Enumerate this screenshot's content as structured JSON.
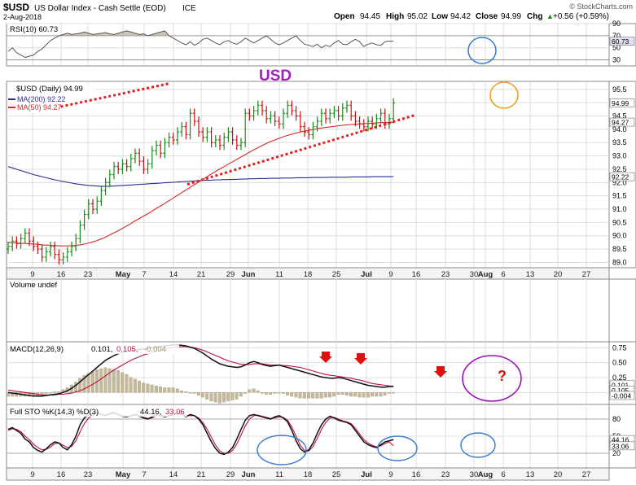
{
  "header": {
    "symbol": "$USD",
    "name": "US Dollar Index - Cash Settle (EOD)",
    "exchange": "ICE",
    "date": "2-Aug-2018",
    "source": "© StockCharts.com",
    "ohlc": [
      {
        "label": "Open",
        "value": "94.45"
      },
      {
        "label": "High",
        "value": "95.02"
      },
      {
        "label": "Low",
        "value": "94.42"
      },
      {
        "label": "Close",
        "value": "94.99"
      },
      {
        "label": "Chg",
        "value": "+0.56 (+0.59%)"
      }
    ],
    "chg_marker": "▲"
  },
  "annotations": {
    "usd_label": "USD",
    "question_mark": "?"
  },
  "colors": {
    "bullish": "#1a8a1a",
    "bearish": "#cc1111",
    "ma200": "#2c2c9a",
    "ma50": "#d42a2a",
    "trendline": "#e02020",
    "rsi": "#555555",
    "volume_hist": "#c4b99a",
    "macd": "#111111",
    "signal": "#c01040",
    "sto_k": "#111111",
    "sto_d": "#c01040",
    "circle_blue": "#3f7fd0",
    "circle_orange": "#f0a020",
    "circle_purple": "#9a10c0",
    "arrow": "#e01010",
    "usd_text": "#a020c0"
  },
  "chart_data": [
    {
      "type": "line",
      "panel": "RSI",
      "legend": "RSI(10) 60.73",
      "ylim": [
        20,
        90
      ],
      "yticks": [
        "90",
        "70",
        "50",
        "30"
      ],
      "last_label": "60.73",
      "last_value": 60.73,
      "series": [
        {
          "name": "RSI(10)",
          "values": [
            44,
            50,
            42,
            38,
            34,
            36,
            38,
            44,
            48,
            55,
            62,
            66,
            70,
            72,
            74,
            72,
            73,
            74,
            76,
            74,
            72,
            73,
            74,
            75,
            73,
            72,
            74,
            76,
            78,
            76,
            74,
            72,
            73,
            70,
            72,
            74,
            76,
            78,
            70,
            66,
            62,
            58,
            55,
            60,
            54,
            58,
            64,
            66,
            62,
            58,
            55,
            60,
            62,
            58,
            56,
            60,
            66,
            62,
            58,
            62,
            66,
            70,
            64,
            58,
            55,
            58,
            62,
            66,
            70,
            62,
            56,
            54,
            52,
            56,
            50,
            54,
            52,
            58,
            62,
            56,
            55,
            60,
            64,
            60,
            52,
            56,
            58,
            55,
            54,
            60,
            61,
            60.73
          ]
        }
      ]
    },
    {
      "type": "candlestick",
      "panel": "Price",
      "legend": "$USD (Daily) 94.99",
      "ylim": [
        88.8,
        95.8
      ],
      "yticks": [
        89,
        89.5,
        90,
        90.5,
        91,
        91.5,
        92,
        92.5,
        93,
        93.5,
        94,
        94.5,
        95,
        95.5
      ],
      "ytick_labels": [
        "89.0",
        "89.5",
        "90.0",
        "90.5",
        "91.0",
        "91.5",
        "92.0",
        "92.5",
        "93.0",
        "93.5",
        "94.0",
        "94.5",
        "95.0",
        "95.5"
      ],
      "x_tick_labels": [
        "9",
        "16",
        "23",
        "May",
        "7",
        "14",
        "21",
        "29",
        "Jun",
        "11",
        "18",
        "25",
        "Jul",
        "9",
        "16",
        "23",
        "30",
        "Aug",
        "6",
        "13",
        "20",
        "27"
      ],
      "x_tick_bold": [
        "May",
        "Jun",
        "Jul",
        "Aug"
      ],
      "close": [
        89.6,
        89.8,
        89.7,
        89.9,
        90.1,
        89.8,
        89.6,
        89.5,
        89.2,
        89.4,
        89.6,
        89.3,
        89.1,
        89.2,
        89.4,
        89.6,
        89.9,
        90.4,
        90.8,
        91.2,
        91.0,
        91.3,
        91.7,
        92.0,
        92.3,
        92.6,
        92.5,
        92.7,
        92.6,
        92.9,
        93.1,
        92.8,
        92.5,
        92.7,
        93.2,
        93.4,
        93.1,
        93.5,
        93.7,
        93.6,
        93.9,
        94.1,
        93.8,
        94.6,
        94.3,
        93.9,
        93.7,
        93.9,
        93.5,
        93.6,
        93.4,
        93.7,
        93.9,
        93.6,
        93.4,
        93.5,
        94.6,
        94.5,
        94.7,
        94.9,
        94.7,
        94.4,
        94.5,
        94.3,
        94.2,
        94.6,
        94.9,
        94.7,
        94.5,
        94.1,
        93.9,
        93.8,
        94.1,
        94.3,
        94.6,
        94.4,
        94.6,
        94.7,
        94.5,
        94.8,
        94.9,
        94.5,
        94.3,
        94.2,
        94.1,
        94.3,
        94.2,
        94.4,
        94.6,
        94.2,
        94.4,
        94.99
      ],
      "ma200": {
        "legend": "MA(200) 92.22",
        "last_label": "92.22",
        "values": [
          92.6,
          92.55,
          92.5,
          92.45,
          92.4,
          92.35,
          92.3,
          92.26,
          92.22,
          92.18,
          92.14,
          92.1,
          92.07,
          92.04,
          92.01,
          91.98,
          91.95,
          91.93,
          91.91,
          91.89,
          91.88,
          91.87,
          91.86,
          91.86,
          91.86,
          91.87,
          91.88,
          91.89,
          91.9,
          91.91,
          91.92,
          91.93,
          91.94,
          91.95,
          91.96,
          91.97,
          91.98,
          91.99,
          92.0,
          92.01,
          92.02,
          92.03,
          92.04,
          92.05,
          92.06,
          92.07,
          92.08,
          92.09,
          92.09,
          92.1,
          92.1,
          92.11,
          92.11,
          92.12,
          92.12,
          92.13,
          92.13,
          92.14,
          92.14,
          92.15,
          92.15,
          92.15,
          92.16,
          92.16,
          92.16,
          92.17,
          92.17,
          92.17,
          92.18,
          92.18,
          92.18,
          92.18,
          92.19,
          92.19,
          92.19,
          92.19,
          92.2,
          92.2,
          92.2,
          92.2,
          92.2,
          92.21,
          92.21,
          92.21,
          92.21,
          92.21,
          92.22,
          92.22,
          92.22,
          92.22,
          92.22,
          92.22
        ]
      },
      "ma50": {
        "legend": "MA(50) 94.27",
        "last_label": "94.27",
        "values": [
          89.75,
          89.74,
          89.73,
          89.72,
          89.71,
          89.7,
          89.69,
          89.68,
          89.66,
          89.65,
          89.64,
          89.63,
          89.62,
          89.62,
          89.62,
          89.63,
          89.64,
          89.66,
          89.69,
          89.73,
          89.77,
          89.82,
          89.88,
          89.95,
          90.03,
          90.11,
          90.19,
          90.28,
          90.37,
          90.46,
          90.56,
          90.65,
          90.74,
          90.83,
          90.93,
          91.03,
          91.12,
          91.22,
          91.32,
          91.42,
          91.52,
          91.62,
          91.72,
          91.82,
          91.92,
          92.02,
          92.12,
          92.22,
          92.32,
          92.42,
          92.51,
          92.6,
          92.69,
          92.78,
          92.87,
          92.96,
          93.05,
          93.14,
          93.23,
          93.31,
          93.39,
          93.47,
          93.54,
          93.6,
          93.66,
          93.72,
          93.77,
          93.82,
          93.86,
          93.9,
          93.93,
          93.96,
          93.99,
          94.02,
          94.05,
          94.07,
          94.09,
          94.11,
          94.13,
          94.15,
          94.17,
          94.18,
          94.19,
          94.2,
          94.21,
          94.22,
          94.23,
          94.24,
          94.25,
          94.25,
          94.26,
          94.27
        ]
      },
      "last_label": "94.99",
      "trendlines": [
        {
          "name": "upper",
          "x": [
            0.09,
            0.27
          ],
          "y": [
            94.85,
            95.72
          ]
        },
        {
          "name": "lower",
          "x": [
            0.3,
            0.68
          ],
          "y": [
            91.93,
            94.55
          ]
        }
      ]
    },
    {
      "type": "bar",
      "panel": "Volume",
      "legend": "Volume undef"
    },
    {
      "type": "line",
      "panel": "MACD",
      "legend_prefix": "MACD(12,26,9)",
      "legend_macd": "0.101,",
      "legend_signal": "0.105,",
      "legend_hist": "-0.004",
      "ylim": [
        -0.2,
        0.85
      ],
      "yticks": [
        0.75,
        0.5,
        0.25
      ],
      "ytick_labels": [
        "0.75",
        "0.50",
        "0.25"
      ],
      "last_labels": [
        "0.101",
        "0.105",
        "-0.004"
      ],
      "series": [
        {
          "name": "MACD",
          "values": [
            0.0,
            -0.01,
            -0.02,
            -0.03,
            -0.04,
            -0.05,
            -0.06,
            -0.06,
            -0.06,
            -0.05,
            -0.04,
            -0.03,
            -0.02,
            0.0,
            0.03,
            0.07,
            0.12,
            0.18,
            0.24,
            0.3,
            0.36,
            0.42,
            0.48,
            0.54,
            0.58,
            0.62,
            0.65,
            0.67,
            0.69,
            0.7,
            0.71,
            0.72,
            0.73,
            0.74,
            0.75,
            0.76,
            0.77,
            0.78,
            0.79,
            0.8,
            0.8,
            0.79,
            0.78,
            0.76,
            0.74,
            0.7,
            0.66,
            0.61,
            0.56,
            0.52,
            0.48,
            0.46,
            0.44,
            0.43,
            0.42,
            0.43,
            0.46,
            0.5,
            0.52,
            0.5,
            0.47,
            0.45,
            0.44,
            0.45,
            0.46,
            0.44,
            0.42,
            0.4,
            0.38,
            0.36,
            0.34,
            0.32,
            0.3,
            0.28,
            0.26,
            0.25,
            0.24,
            0.24,
            0.25,
            0.24,
            0.22,
            0.2,
            0.18,
            0.16,
            0.14,
            0.12,
            0.11,
            0.1,
            0.09,
            0.09,
            0.1,
            0.101
          ]
        },
        {
          "name": "Signal",
          "values": [
            0.04,
            0.03,
            0.02,
            0.01,
            0.0,
            -0.01,
            -0.02,
            -0.03,
            -0.04,
            -0.04,
            -0.04,
            -0.04,
            -0.03,
            -0.03,
            -0.02,
            -0.01,
            0.01,
            0.03,
            0.06,
            0.1,
            0.14,
            0.18,
            0.23,
            0.28,
            0.33,
            0.38,
            0.42,
            0.46,
            0.5,
            0.54,
            0.57,
            0.6,
            0.63,
            0.65,
            0.67,
            0.69,
            0.71,
            0.73,
            0.74,
            0.75,
            0.76,
            0.77,
            0.77,
            0.76,
            0.75,
            0.73,
            0.71,
            0.68,
            0.65,
            0.62,
            0.59,
            0.56,
            0.53,
            0.51,
            0.49,
            0.47,
            0.47,
            0.47,
            0.48,
            0.48,
            0.48,
            0.47,
            0.46,
            0.46,
            0.46,
            0.45,
            0.45,
            0.44,
            0.43,
            0.42,
            0.4,
            0.38,
            0.36,
            0.34,
            0.32,
            0.3,
            0.29,
            0.28,
            0.27,
            0.26,
            0.25,
            0.24,
            0.22,
            0.21,
            0.19,
            0.17,
            0.15,
            0.14,
            0.13,
            0.12,
            0.11,
            0.105
          ]
        }
      ],
      "hist_color": "#c4b99a"
    },
    {
      "type": "line",
      "panel": "Full STO",
      "legend_prefix": "Full STO %K(14,3) %D(3)",
      "legend_k": "44.16,",
      "legend_d": "33.06",
      "ylim": [
        0,
        100
      ],
      "yticks": [
        80,
        50,
        20
      ],
      "ytick_labels": [
        "80",
        "50",
        "20"
      ],
      "last_labels": [
        "44.16",
        "33.06"
      ],
      "series": [
        {
          "name": "%K",
          "values": [
            62,
            65,
            60,
            55,
            45,
            40,
            30,
            25,
            22,
            28,
            35,
            40,
            38,
            30,
            26,
            35,
            50,
            70,
            82,
            88,
            90,
            92,
            88,
            86,
            90,
            92,
            88,
            85,
            84,
            86,
            88,
            85,
            82,
            80,
            84,
            88,
            86,
            84,
            86,
            88,
            90,
            88,
            84,
            88,
            86,
            80,
            70,
            55,
            40,
            28,
            20,
            18,
            22,
            30,
            45,
            62,
            78,
            86,
            88,
            86,
            84,
            82,
            80,
            84,
            86,
            82,
            75,
            60,
            42,
            28,
            22,
            26,
            38,
            55,
            70,
            80,
            85,
            82,
            78,
            76,
            74,
            70,
            60,
            50,
            40,
            35,
            32,
            30,
            35,
            40,
            42,
            44.16
          ]
        },
        {
          "name": "%D",
          "values": [
            60,
            63,
            62,
            58,
            50,
            44,
            36,
            30,
            26,
            27,
            31,
            37,
            38,
            34,
            30,
            32,
            42,
            58,
            72,
            82,
            87,
            90,
            89,
            87,
            88,
            90,
            89,
            86,
            85,
            85,
            87,
            86,
            83,
            81,
            82,
            86,
            86,
            85,
            85,
            87,
            89,
            88,
            86,
            86,
            86,
            82,
            74,
            62,
            48,
            34,
            24,
            20,
            20,
            25,
            36,
            52,
            68,
            80,
            86,
            87,
            85,
            83,
            81,
            82,
            84,
            83,
            78,
            66,
            50,
            34,
            25,
            24,
            32,
            46,
            62,
            74,
            82,
            83,
            80,
            77,
            75,
            72,
            64,
            54,
            44,
            38,
            34,
            31,
            33,
            37,
            40,
            33.06
          ]
        }
      ]
    }
  ]
}
